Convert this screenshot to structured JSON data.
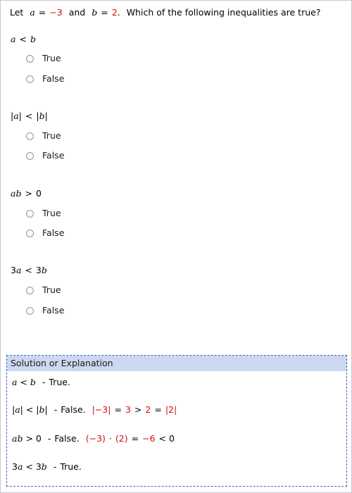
{
  "prompt": {
    "lead": "Let",
    "var_a": "a",
    "eq1": "=",
    "val_a": "−3",
    "conj": "and",
    "var_b": "b",
    "eq2": "=",
    "val_b": "2",
    "period": ".",
    "question": "Which of the following inequalities are true?"
  },
  "colors": {
    "accent_red": "#cc1111",
    "solution_header_bg": "#ccd7f0",
    "solution_border": "#3a62c8",
    "page_border": "#c8c8c8"
  },
  "questions": [
    {
      "expr": {
        "parts": [
          "a",
          "<",
          "b"
        ]
      },
      "options": [
        {
          "label": "True",
          "selected": false
        },
        {
          "label": "False",
          "selected": false
        }
      ]
    },
    {
      "expr": {
        "parts": [
          "|a|",
          "<",
          "|b|"
        ]
      },
      "options": [
        {
          "label": "True",
          "selected": false
        },
        {
          "label": "False",
          "selected": false
        }
      ]
    },
    {
      "expr": {
        "parts": [
          "ab",
          ">",
          "0"
        ]
      },
      "options": [
        {
          "label": "True",
          "selected": false
        },
        {
          "label": "False",
          "selected": false
        }
      ]
    },
    {
      "expr": {
        "parts": [
          "3a",
          "<",
          "3b"
        ]
      },
      "options": [
        {
          "label": "True",
          "selected": false
        },
        {
          "label": "False",
          "selected": false
        }
      ]
    }
  ],
  "solution": {
    "header": "Solution or Explanation",
    "lines": [
      {
        "id": "sol-1",
        "expr": "a < b",
        "dash": "-",
        "verdict": "True.",
        "work": ""
      },
      {
        "id": "sol-2",
        "expr": "|a| < |b|",
        "dash": "-",
        "verdict": "False.",
        "work_red_1": "|−3|",
        "work_black_1": "=",
        "work_red_2": "3",
        "work_black_2": ">",
        "work_red_3": "2",
        "work_black_3": "=",
        "work_red_4": "|2|"
      },
      {
        "id": "sol-3",
        "expr": "ab > 0",
        "dash": "-",
        "verdict": "False.",
        "work_red_1": "(−3)",
        "work_black_1": "·",
        "work_red_2": "(2)",
        "work_black_2": "=",
        "work_red_3": "−6",
        "work_black_3": "< 0"
      },
      {
        "id": "sol-4",
        "expr": "3a < 3b",
        "dash": "-",
        "verdict": "True.",
        "work": ""
      }
    ]
  }
}
